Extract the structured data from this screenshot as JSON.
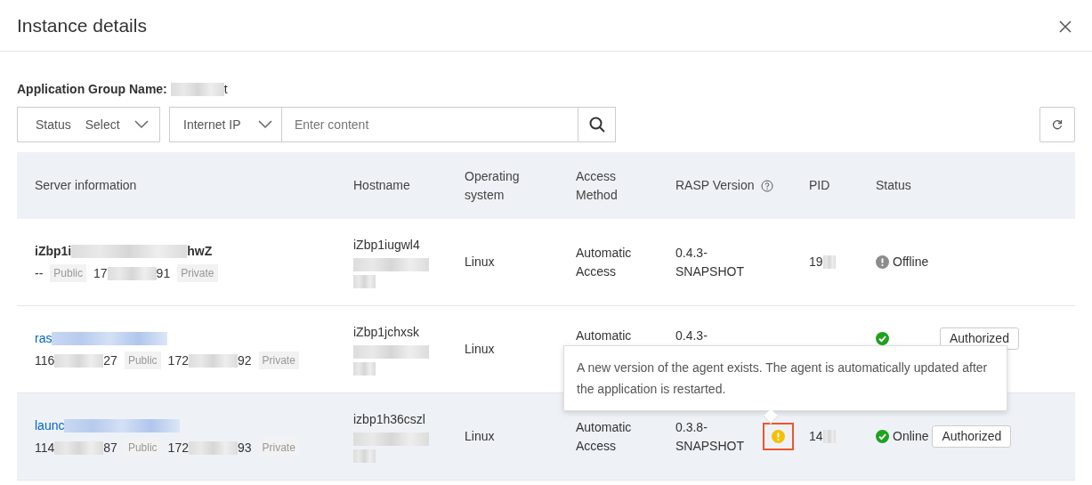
{
  "dialog": {
    "title": "Instance details"
  },
  "group": {
    "label": "Application Group Name:",
    "value_tail": "t"
  },
  "filters": {
    "status": {
      "label": "Status",
      "placeholder": "Select"
    },
    "ip_type": {
      "value": "Internet IP"
    },
    "search": {
      "placeholder": "Enter content"
    }
  },
  "table": {
    "columns": [
      {
        "label": "Server information"
      },
      {
        "label": "Hostname"
      },
      {
        "label": "Operating system"
      },
      {
        "label": "Access Method"
      },
      {
        "label": "RASP Version",
        "help": true
      },
      {
        "label": "PID"
      },
      {
        "label": "Status"
      }
    ],
    "rows": [
      {
        "name": [
          "iZbp1i",
          "hwZ"
        ],
        "name_redacted_tail": false,
        "link": false,
        "highlighted": false,
        "ips": [
          {
            "parts": [
              "--"
            ],
            "tag": "Public"
          },
          {
            "parts": [
              "17",
              "91"
            ],
            "tag": "Private"
          }
        ],
        "hostname": "iZbp1iugwl4",
        "os": "Linux",
        "access": "Automatic Access",
        "version": "0.4.3-SNAPSHOT",
        "update_warning": false,
        "pid": "19",
        "status": {
          "kind": "offline",
          "label": "Offline"
        }
      },
      {
        "name": [
          "ras"
        ],
        "name_redacted_tail": true,
        "link": true,
        "highlighted": false,
        "ips": [
          {
            "parts": [
              "116",
              "27"
            ],
            "tag": "Public"
          },
          {
            "parts": [
              "172",
              "92"
            ],
            "tag": "Private"
          }
        ],
        "hostname": "iZbp1jchxsk",
        "os": "Linux",
        "access": "Automatic",
        "version": "0.4.3-",
        "update_warning": false,
        "status": {
          "kind": "online"
        },
        "auth": "Authorized"
      },
      {
        "name": [
          "launc"
        ],
        "name_redacted_tail": true,
        "link": true,
        "highlighted": true,
        "ips": [
          {
            "parts": [
              "114",
              "87"
            ],
            "tag": "Public"
          },
          {
            "parts": [
              "172",
              "93"
            ],
            "tag": "Private"
          }
        ],
        "hostname": "izbp1h36cszl",
        "os": "Linux",
        "access": "Automatic Access",
        "version": "0.3.8-SNAPSHOT",
        "update_warning": true,
        "pid": "14",
        "status": {
          "kind": "online",
          "label": "Online"
        },
        "auth": "Authorized"
      }
    ]
  },
  "tooltip": {
    "text": "A new version of the agent exists. The agent is automatically updated after the application is restarted."
  }
}
